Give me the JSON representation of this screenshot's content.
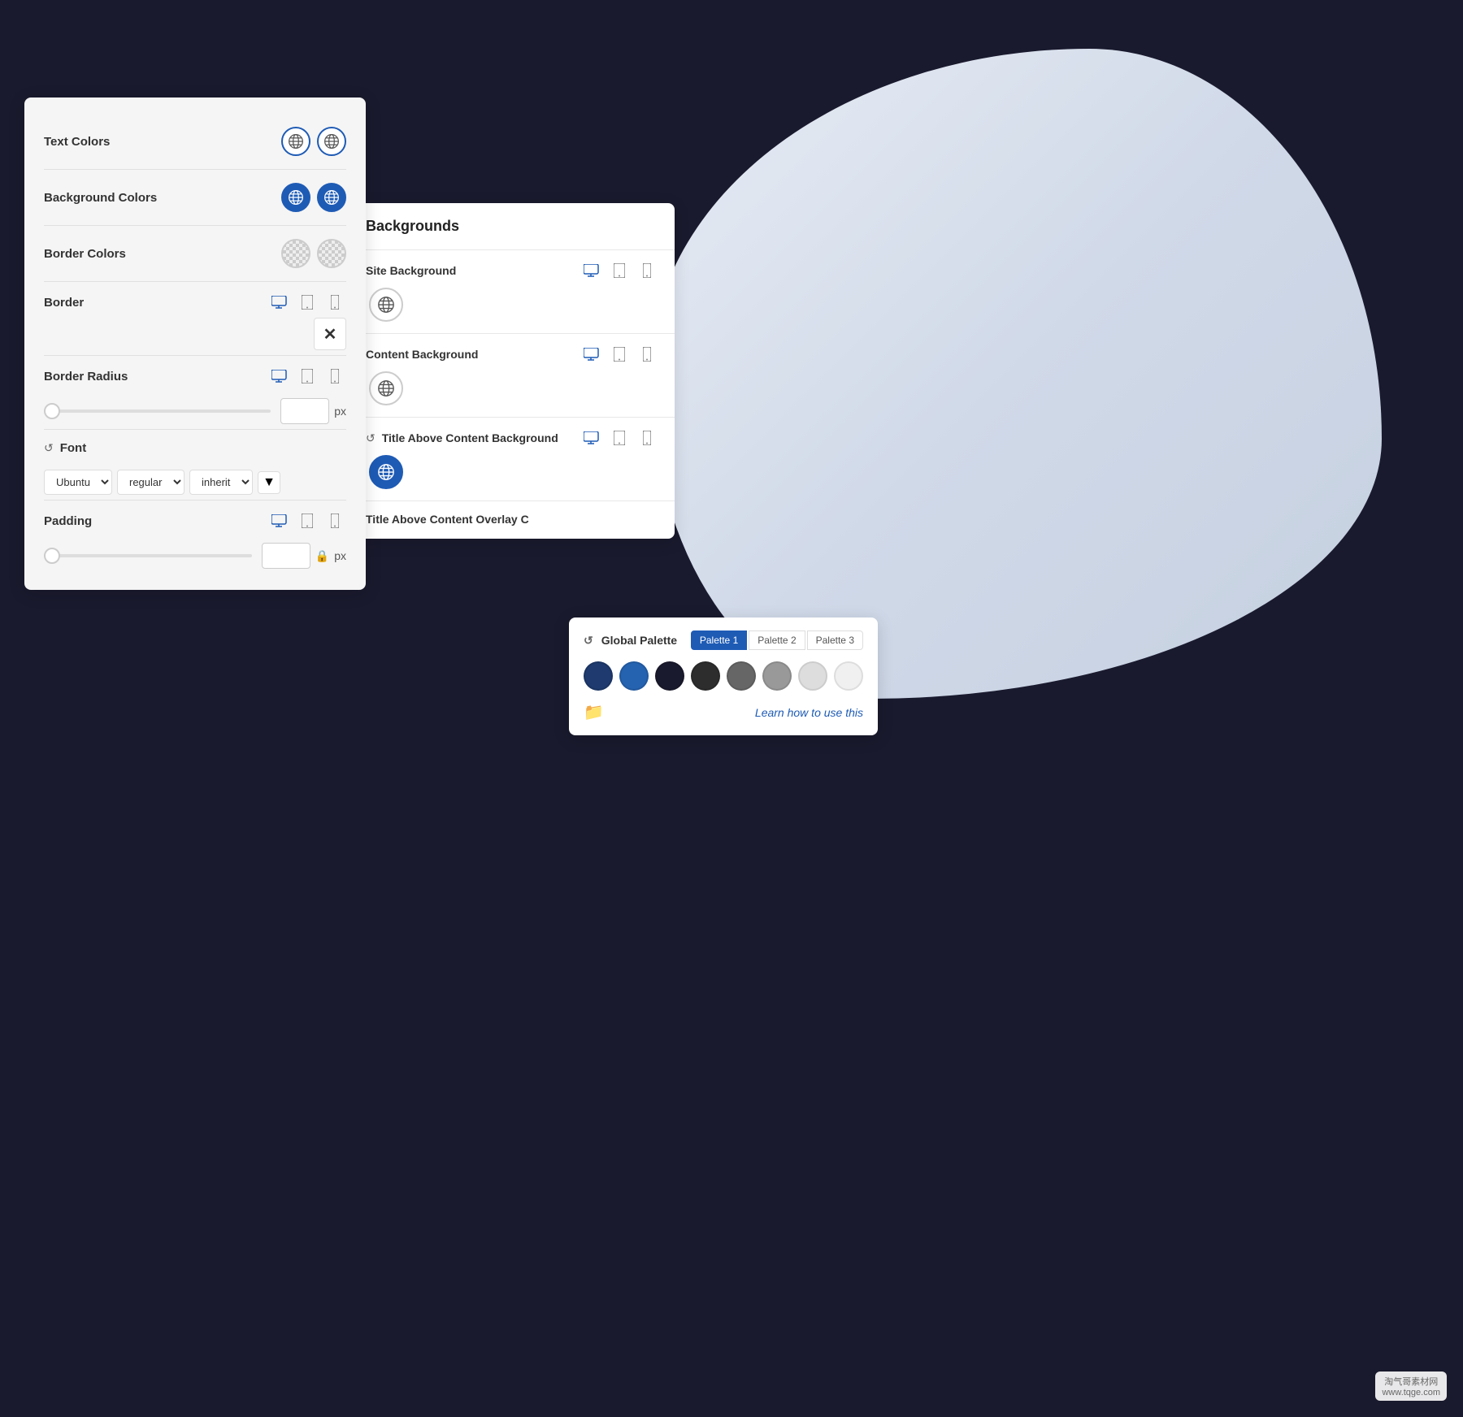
{
  "background": {
    "color": "#1a1a2e"
  },
  "left_panel": {
    "rows": [
      {
        "id": "text-colors",
        "label": "Text Colors",
        "type": "globe-pair",
        "globe1_filled": false,
        "globe2_filled": false
      },
      {
        "id": "background-colors",
        "label": "Background Colors",
        "type": "globe-pair",
        "globe1_filled": true,
        "globe2_filled": true
      },
      {
        "id": "border-colors",
        "label": "Border Colors",
        "type": "globe-pair-checkered",
        "globe1_filled": false,
        "globe2_filled": false
      },
      {
        "id": "border",
        "label": "Border",
        "type": "devices-x"
      },
      {
        "id": "border-radius",
        "label": "Border Radius",
        "type": "devices-slider"
      },
      {
        "id": "font",
        "label": "Font",
        "type": "font-row",
        "font_value": "Ubuntu",
        "weight_value": "regular",
        "size_value": "inherit"
      },
      {
        "id": "padding",
        "label": "Padding",
        "type": "devices-slider-lock"
      }
    ]
  },
  "backgrounds_panel": {
    "title": "Backgrounds",
    "rows": [
      {
        "id": "site-background",
        "label": "Site Background",
        "globe_filled": false
      },
      {
        "id": "content-background",
        "label": "Content Background",
        "globe_filled": false
      },
      {
        "id": "title-above-content-bg",
        "label": "Title Above Content Background",
        "globe_filled": true,
        "has_reset": true
      },
      {
        "id": "title-above-content-overlay",
        "label": "Title Above Content Overlay C",
        "globe_filled": false,
        "truncated": true
      }
    ]
  },
  "palette_panel": {
    "title": "Global Palette",
    "tabs": [
      "Palette 1",
      "Palette 2",
      "Palette 3"
    ],
    "active_tab": 0,
    "swatches": [
      "#1e3a6e",
      "#2563b0",
      "#1a1a2e",
      "#2d2d2d",
      "#555555",
      "#888888",
      "#cccccc",
      "#eeeeee"
    ],
    "learn_link": "Learn how to use this"
  }
}
